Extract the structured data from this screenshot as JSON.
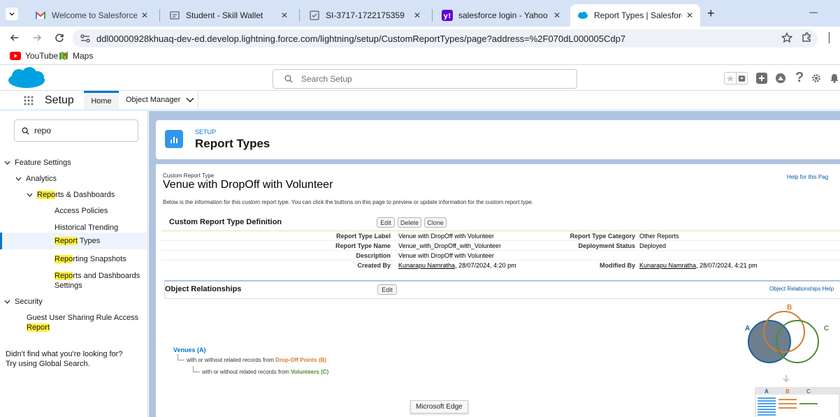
{
  "browser": {
    "tabs": [
      {
        "title": "Welcome to Salesforce: Verify y",
        "close": "✕"
      },
      {
        "title": "Student - Skill Wallet",
        "close": "✕"
      },
      {
        "title": "SI-3717-1722175359",
        "close": "✕"
      },
      {
        "title": "salesforce login - Yahoo India S",
        "close": "✕"
      },
      {
        "title": "Report Types | Salesforce",
        "close": "✕"
      }
    ],
    "new_tab": "+",
    "minimize": "—",
    "url": "ddl00000928khuaq-dev-ed.develop.lightning.force.com/lightning/setup/CustomReportTypes/page?address=%2F070dL000005Cdp7",
    "bookmarks": [
      "YouTube",
      "Maps"
    ]
  },
  "sf": {
    "search_placeholder": "Search Setup",
    "app_name": "Setup",
    "nav_home": "Home",
    "nav_object_manager": "Object Manager"
  },
  "sidebar": {
    "quickfind_value": "repo",
    "feature_settings": "Feature Settings",
    "analytics": "Analytics",
    "reports_dashboards_hl": "Repo",
    "reports_dashboards_rest": "rts & Dashboards",
    "access_policies": "Access Policies",
    "historical_trending": "Historical Trending",
    "report_types_hl": "Report",
    "report_types_rest": " Types",
    "reporting_snapshots_hl": "Repo",
    "reporting_snapshots_rest": "rting Snapshots",
    "reports_settings_hl": "Repo",
    "reports_settings_rest": "rts and Dashboards",
    "reports_settings_line2": "Settings",
    "security": "Security",
    "guest_user_line1": "Guest User Sharing Rule Access",
    "guest_user_hl": "Report",
    "not_found_line1": "Didn't find what you're looking for?",
    "not_found_line2": "Try using Global Search."
  },
  "header": {
    "eyebrow": "SETUP",
    "title": "Report Types"
  },
  "page": {
    "crumb": "Custom Report Type",
    "title": "Venue with DropOff with Volunteer",
    "help_link": "Help for this Pag",
    "intro": "Below is the information for this custom report type. You can click the buttons on this page to preview or update information for the custom report type.",
    "definition_heading": "Custom Report Type Definition",
    "btn_edit": "Edit",
    "btn_delete": "Delete",
    "btn_clone": "Clone",
    "fields": {
      "label_k": "Report Type Label",
      "label_v": "Venue with DropOff with Volunteer",
      "name_k": "Report Type Name",
      "name_v": "Venue_with_DropOff_with_Volunteer",
      "desc_k": "Description",
      "desc_v": "Venue with DropOff with Volunteer",
      "created_k": "Created By",
      "created_user": "Kunarapu Namratha",
      "created_date": ", 28/07/2024, 4:20 pm",
      "category_k": "Report Type Category",
      "category_v": "Other Reports",
      "deploy_k": "Deployment Status",
      "deploy_v": "Deployed",
      "modified_k": "Modified By",
      "modified_user": "Kunarapu Namratha",
      "modified_date": ", 28/07/2024, 4:21 pm"
    },
    "relationships_heading": "Object Relationships",
    "relationships_edit": "Edit",
    "relationships_help": "Object Relationships Help",
    "venues": "Venues (A)",
    "rel_prefix": "with or without related records from",
    "dropoff": "Drop-Off Points (B)",
    "volunteers": "Volunteers (C)",
    "venn": {
      "a": "A",
      "b": "B",
      "c": "C"
    },
    "tooltip": "Microsoft Edge"
  },
  "colors": {
    "accent": "#0176d3",
    "orange": "#d57c2d",
    "green": "#4d8b31",
    "highlight": "#fff03f"
  }
}
